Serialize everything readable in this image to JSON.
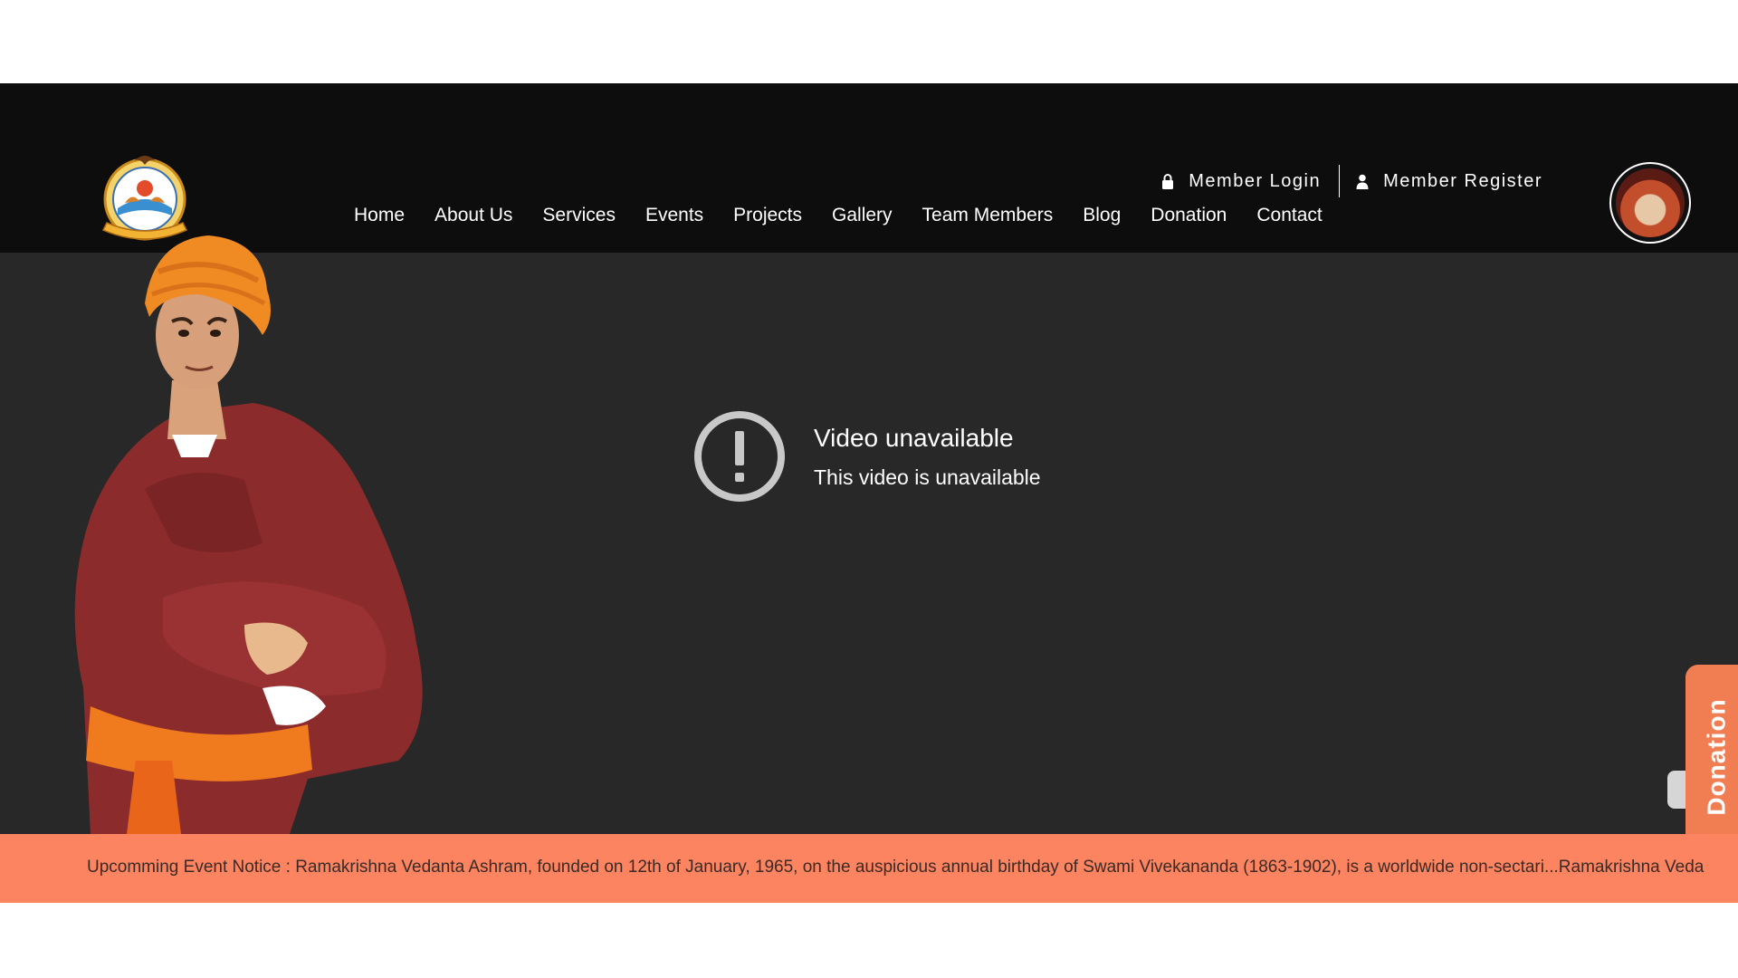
{
  "header": {
    "account_links": {
      "login": "Member Login",
      "register": "Member Register"
    },
    "nav": [
      {
        "label": "Home"
      },
      {
        "label": "About Us"
      },
      {
        "label": "Services"
      },
      {
        "label": "Events"
      },
      {
        "label": "Projects"
      },
      {
        "label": "Gallery"
      },
      {
        "label": "Team Members"
      },
      {
        "label": "Blog"
      },
      {
        "label": "Donation"
      },
      {
        "label": "Contact"
      }
    ]
  },
  "video": {
    "title": "Video unavailable",
    "subtitle": "This video is unavailable",
    "icon": "alert-circle-icon"
  },
  "donation_tab": {
    "label": "Donation"
  },
  "ticker": {
    "text": "Upcomming Event Notice : Ramakrishna Vedanta Ashram, founded on 12th of January, 1965, on the auspicious annual birthday of Swami Vivekananda (1863-1902), is a worldwide non-sectari...Ramakrishna Veda"
  },
  "colors": {
    "header_bg": "#0d0d0d",
    "video_bg": "#282828",
    "ticker_bg": "#fd8460",
    "donation_accent": "#f17d52"
  }
}
